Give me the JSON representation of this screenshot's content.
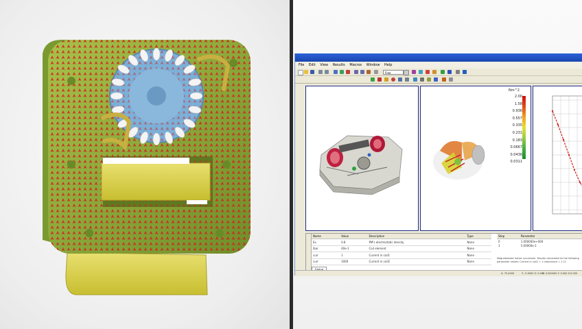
{
  "menu": [
    "File",
    "Edit",
    "View",
    "Results",
    "Macros",
    "Window",
    "Help"
  ],
  "toolbar": {
    "zoom_value": "Free"
  },
  "legend": {
    "title": "Nm^2",
    "values": [
      "2.00",
      "1.58",
      "0.936",
      "0.557",
      "0.335",
      "0.231",
      "0.183",
      "0.0667",
      "0.0436",
      "0.0311",
      "0"
    ]
  },
  "property_table": {
    "headers": [
      "Name",
      "Value",
      "Description",
      "Type"
    ],
    "rows": [
      [
        "Ex",
        "0.8",
        "PM's electrostatic density",
        "None"
      ],
      [
        "lbar",
        "40e-1",
        "Coil element",
        "None"
      ],
      [
        "curr",
        "1",
        "Current in coil1",
        "None"
      ],
      [
        "curr",
        "1000",
        "Current in coil2",
        "None"
      ]
    ],
    "tab": "Global"
  },
  "info_table": {
    "headers": [
      "Step",
      "Parameter"
    ],
    "rows": [
      [
        "0",
        "1.000000e+000"
      ],
      [
        "1",
        "5.00000e-1"
      ]
    ],
    "message": "Magnetostatic  Solver successful. Results calculated for the following parameter values: Current in coil1 = 1 Inductance = 1.11"
  },
  "statusbar": {
    "left": "",
    "coords": "X: 75.4000",
    "coords2": "Y: -5.9000 Z: 0.000",
    "right": "Z: 0.000000 Y: 0.000 Z:0.000"
  },
  "colors": {
    "window_chrome": "#ece9d8",
    "titlebar": "#1f52c4",
    "viewport_border": "#1c2a8a",
    "motor_body": "#8bae3a",
    "magnet": "#d8d040",
    "arrow_red": "#d42020",
    "plot_line": "#d02020"
  }
}
